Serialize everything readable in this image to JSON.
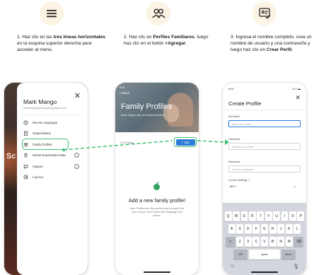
{
  "steps": [
    {
      "icon": "hamburger-menu-icon",
      "text_prefix": "1. Haz clic en las ",
      "text_bold": "tres líneas horizontales",
      "text_suffix": " en la esquina superior derecha para acceder al menú."
    },
    {
      "icon": "people-icon",
      "text_prefix": "2. Haz clic en ",
      "text_bold": "Perfiles Familiares",
      "text_middle": ", luego haz clic en el botón ",
      "text_bold2": "+Agregar",
      "text_suffix": "."
    },
    {
      "icon": "profile-card-icon",
      "text_prefix": "3. Ingresa el nombre completo, crea un nombre de usuario y una contraseña y luego haz clic en ",
      "text_bold": "Crear Perfil",
      "text_suffix": "."
    }
  ],
  "phone1": {
    "user_name": "Mark Mango",
    "user_email": "markmango@mangolanguages.com",
    "close_glyph": "✕",
    "background_letters": "Sc",
    "menu_items": [
      {
        "label": "Recent Languages",
        "icon": "clock-icon"
      },
      {
        "label": "Organizations",
        "icon": "building-icon"
      },
      {
        "label": "Family Profiles",
        "icon": "family-icon",
        "active": true
      },
      {
        "label": "Delete Downloaded Data",
        "icon": "trash-icon",
        "info": "i"
      },
      {
        "label": "Support",
        "icon": "chat-icon",
        "info": "i"
      },
      {
        "label": "Log Out",
        "icon": "logout-icon"
      }
    ]
  },
  "phone2": {
    "status_time": "9:41",
    "back_label": "< Back",
    "title": "Family Profiles",
    "subtitle": "Share Mango with your family members",
    "used_label": "0 of 5 used",
    "add_button": "+ Add",
    "empty_title": "Add a new family profile!",
    "empty_text": "User Profiles are the perfect way to enrich the lives of your loved ones with language and culture."
  },
  "phone3": {
    "status_time": "9:41",
    "status_right": "•ıl ≈ ▬",
    "close_glyph": "✕",
    "title": "Create Profile",
    "fields": [
      {
        "label": "Full Name",
        "placeholder": "Enter your name",
        "focused": true
      },
      {
        "label": "Username",
        "placeholder": "Create a username"
      },
      {
        "label": "Password",
        "placeholder": "Create a password"
      }
    ],
    "content_settings_label": "Content Settings ⓘ",
    "content_settings_value": "MG+",
    "keyboard_rows": [
      [
        "Q",
        "W",
        "E",
        "R",
        "T",
        "Y",
        "U",
        "I",
        "O",
        "P"
      ],
      [
        "A",
        "S",
        "D",
        "F",
        "G",
        "H",
        "J",
        "K",
        "L"
      ],
      [
        "⇧",
        "Z",
        "X",
        "C",
        "V",
        "B",
        "N",
        "M",
        "⌫"
      ]
    ],
    "key_123": "123",
    "key_space": "space",
    "key_return": "return",
    "emoji_glyph": "☺",
    "mic_glyph": "🎙"
  },
  "colors": {
    "accent_green": "#3fbf73",
    "button_blue": "#2d7bd8",
    "icon_circle_bg": "#fbf4e4"
  }
}
